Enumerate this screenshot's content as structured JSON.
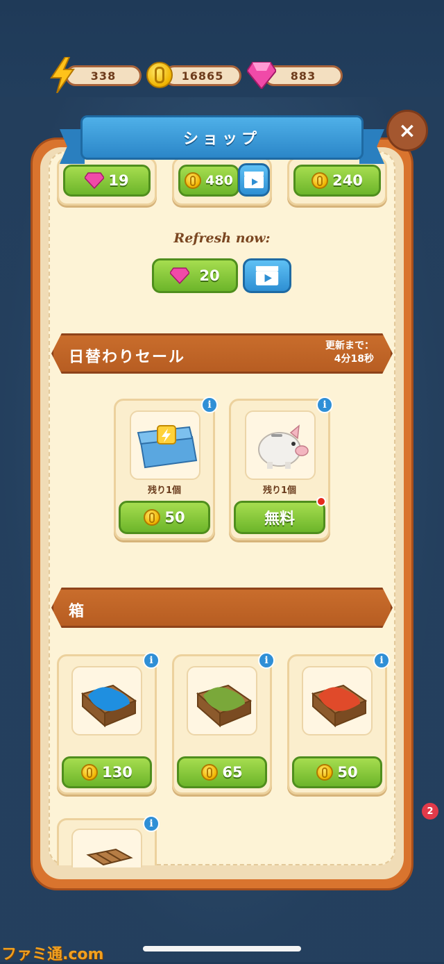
{
  "resources": {
    "energy": "338",
    "coins": "16865",
    "gems": "883"
  },
  "shop": {
    "title": "ショップ",
    "close_label": "×"
  },
  "top_offers": [
    {
      "currency": "gem",
      "price": "19"
    },
    {
      "currency": "coin",
      "price": "480"
    },
    {
      "currency": "coin",
      "price": "240"
    }
  ],
  "refresh": {
    "label": "Refresh now:",
    "gem_price": "20"
  },
  "daily_sale": {
    "title": "日替わりセール",
    "timer_line1": "更新まで：",
    "timer_line2": "4分18秒",
    "items": [
      {
        "name": "energy-chest",
        "remaining": "残り1個",
        "price": "50",
        "currency": "coin"
      },
      {
        "name": "piggy-bank",
        "remaining": "残り1個",
        "price": "無料",
        "currency": "free"
      }
    ]
  },
  "boxes": {
    "title": "箱",
    "items": [
      {
        "name": "blue-box",
        "price": "130",
        "color": "#1f8fe0"
      },
      {
        "name": "green-box",
        "price": "65",
        "color": "#7aa83a"
      },
      {
        "name": "red-box",
        "price": "50",
        "color": "#e04a2a"
      }
    ]
  },
  "watermark": "ファミ通.com",
  "side_badge": "2",
  "colors": {
    "panel_orange": "#d9742e",
    "ribbon_blue": "#2b86c8",
    "button_green": "#6cb52a"
  }
}
